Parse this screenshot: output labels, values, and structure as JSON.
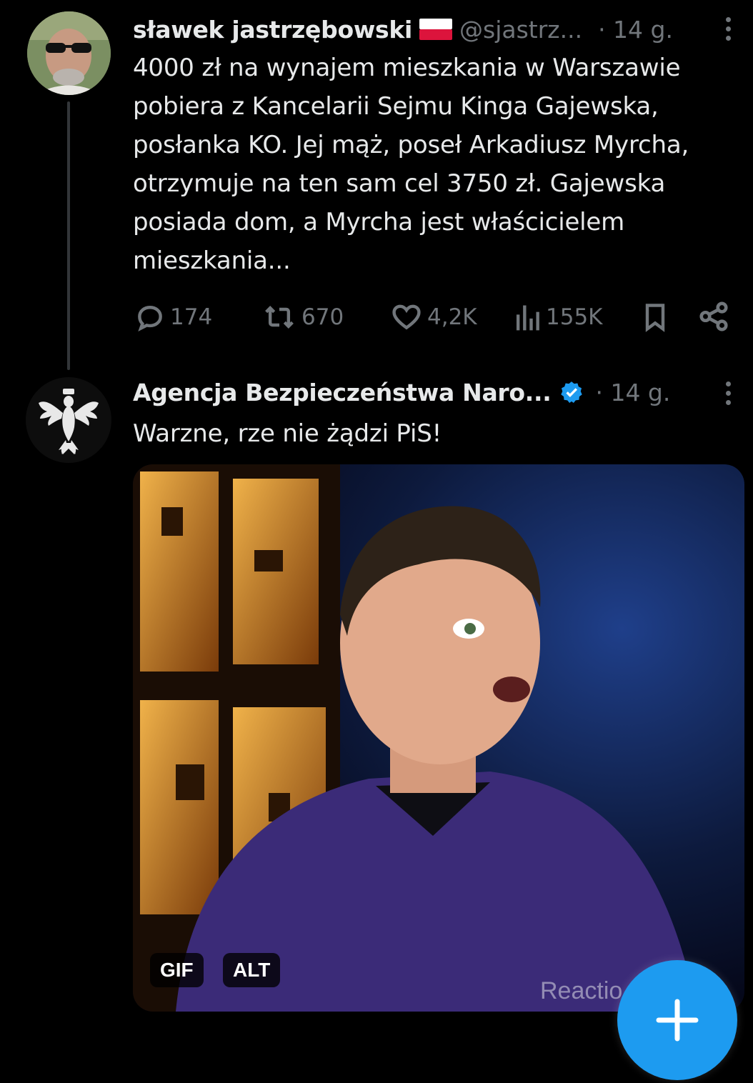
{
  "tweet1": {
    "display_name": "sławek jastrzębowski",
    "handle": "@sjastrz...",
    "time": "· 14 g.",
    "text_lines": [
      "4000 zł na wynajem mieszkania w Warszawie",
      "pobiera z Kancelarii Sejmu Kinga Gajewska,",
      "posłanka KO. Jej mąż, poseł Arkadiusz Myrcha,",
      "otrzymuje na ten sam cel 3750 zł. Gajewska",
      "posiada dom, a Myrcha jest właścicielem",
      "mieszkania..."
    ],
    "replies": "174",
    "reposts": "670",
    "likes": "4,2K",
    "views": "155K"
  },
  "tweet2": {
    "display_name": "Agencja Bezpieczeństwa Naro...",
    "time": "· 14 g.",
    "text": "Warzne, rze nie żądzi PiS!",
    "media": {
      "gif_label": "GIF",
      "alt_label": "ALT",
      "watermark": "Reactio"
    }
  },
  "colors": {
    "background": "#000000",
    "text": "#e7e9ea",
    "muted": "#71767b",
    "accent": "#1d9bf0"
  },
  "icons": {
    "reply": "reply-icon",
    "repost": "repost-icon",
    "like": "heart-icon",
    "views": "views-icon",
    "bookmark": "bookmark-icon",
    "share": "share-icon",
    "verified": "verified-badge-icon",
    "flag": "poland-flag-icon",
    "compose": "plus-icon"
  }
}
